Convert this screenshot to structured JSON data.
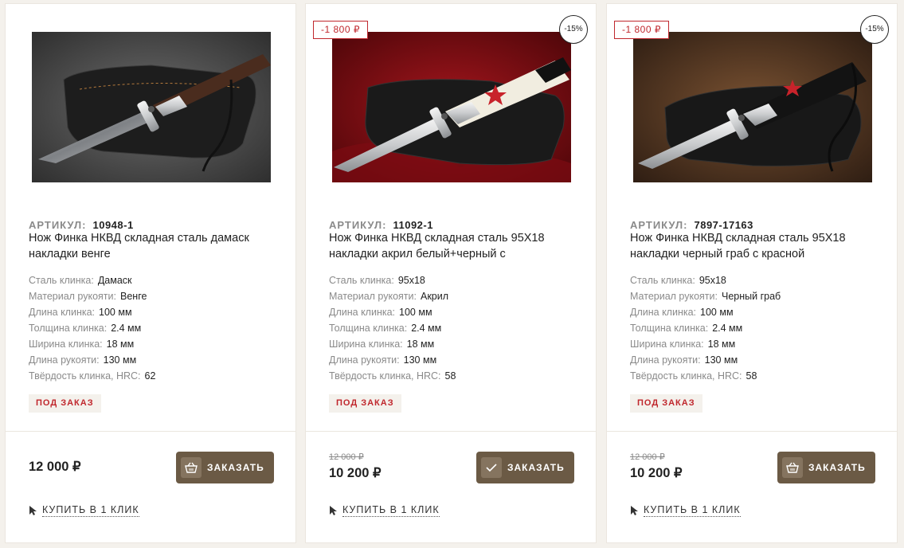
{
  "colors": {
    "accent": "#6b5a45",
    "sale": "#c0272d",
    "muted": "#8a8a8a"
  },
  "products": [
    {
      "sku_label": "АРТИКУЛ:",
      "sku": "10948-1",
      "title": "Нож Финка НКВД складная сталь дамаск накладки венге",
      "specs": [
        {
          "k": "Сталь клинка:",
          "v": "Дамаск"
        },
        {
          "k": "Материал рукояти:",
          "v": "Венге"
        },
        {
          "k": "Длина клинка:",
          "v": "100 мм"
        },
        {
          "k": "Толщина клинка:",
          "v": "2.4 мм"
        },
        {
          "k": "Ширина клинка:",
          "v": "18 мм"
        },
        {
          "k": "Длина рукояти:",
          "v": "130 мм"
        },
        {
          "k": "Твёрдость клинка, HRC:",
          "v": "62"
        }
      ],
      "badge": "ПОД ЗАКАЗ",
      "price": "12 000 ₽",
      "order_label": "ЗАКАЗАТЬ",
      "order_icon": "basket-icon",
      "oneclick_label": "КУПИТЬ В 1 КЛИК"
    },
    {
      "discount": "-1 800 ₽",
      "percent": "-15%",
      "sku_label": "АРТИКУЛ:",
      "sku": "11092-1",
      "title": "Нож Финка НКВД складная сталь 95Х18 накладки акрил белый+черный с",
      "specs": [
        {
          "k": "Сталь клинка:",
          "v": "95х18"
        },
        {
          "k": "Материал рукояти:",
          "v": "Акрил"
        },
        {
          "k": "Длина клинка:",
          "v": "100 мм"
        },
        {
          "k": "Толщина клинка:",
          "v": "2.4 мм"
        },
        {
          "k": "Ширина клинка:",
          "v": "18 мм"
        },
        {
          "k": "Длина рукояти:",
          "v": "130 мм"
        },
        {
          "k": "Твёрдость клинка, HRC:",
          "v": "58"
        }
      ],
      "badge": "ПОД ЗАКАЗ",
      "old_price": "12 000 ₽",
      "price": "10 200 ₽",
      "order_label": "ЗАКАЗАТЬ",
      "order_icon": "checkmark-icon",
      "oneclick_label": "КУПИТЬ В 1 КЛИК"
    },
    {
      "discount": "-1 800 ₽",
      "percent": "-15%",
      "sku_label": "АРТИКУЛ:",
      "sku": "7897-17163",
      "title": "Нож Финка НКВД складная сталь 95Х18 накладки черный граб с красной",
      "specs": [
        {
          "k": "Сталь клинка:",
          "v": "95х18"
        },
        {
          "k": "Материал рукояти:",
          "v": "Черный граб"
        },
        {
          "k": "Длина клинка:",
          "v": "100 мм"
        },
        {
          "k": "Толщина клинка:",
          "v": "2.4 мм"
        },
        {
          "k": "Ширина клинка:",
          "v": "18 мм"
        },
        {
          "k": "Длина рукояти:",
          "v": "130 мм"
        },
        {
          "k": "Твёрдость клинка, HRC:",
          "v": "58"
        }
      ],
      "badge": "ПОД ЗАКАЗ",
      "old_price": "12 000 ₽",
      "price": "10 200 ₽",
      "order_label": "ЗАКАЗАТЬ",
      "order_icon": "basket-icon",
      "oneclick_label": "КУПИТЬ В 1 КЛИК"
    }
  ]
}
